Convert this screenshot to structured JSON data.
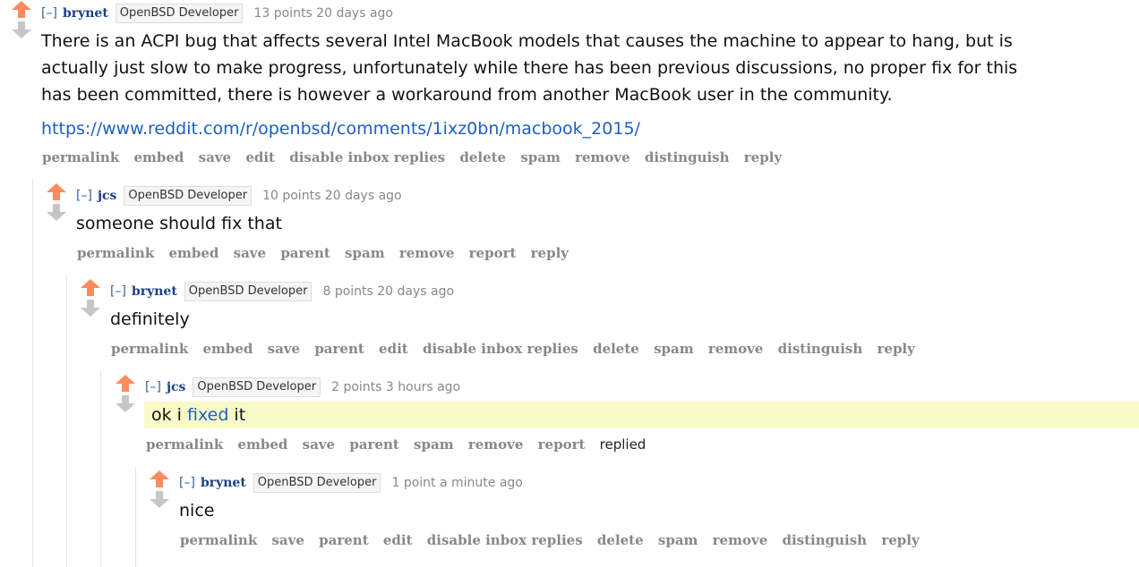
{
  "colors": {
    "upvote": "#ff8b60",
    "downvote": "#c6c6c6",
    "author": "#1a3f88",
    "link": "#1e5fc4",
    "highlight": "#fafac8"
  },
  "comments": [
    {
      "expand": "[–]",
      "author": "brynet",
      "flair": "OpenBSD Developer",
      "score": "13 points 20 days ago",
      "body_lines": [
        "There is an ACPI bug that affects several Intel MacBook models that causes the machine to appear to hang, but is",
        "actually just slow to make progress, unfortunately while there has been previous discussions, no proper fix for this",
        "has been committed, there is however a workaround from another MacBook user in the community."
      ],
      "link": "https://www.reddit.com/r/openbsd/comments/1ixz0bn/macbook_2015/",
      "buttons": [
        "permalink",
        "embed",
        "save",
        "edit",
        "disable inbox replies",
        "delete",
        "spam",
        "remove",
        "distinguish",
        "reply"
      ]
    },
    {
      "expand": "[–]",
      "author": "jcs",
      "flair": "OpenBSD Developer",
      "score": "10 points 20 days ago",
      "body": "someone should fix that",
      "buttons": [
        "permalink",
        "embed",
        "save",
        "parent",
        "spam",
        "remove",
        "report",
        "reply"
      ]
    },
    {
      "expand": "[–]",
      "author": "brynet",
      "flair": "OpenBSD Developer",
      "score": "8 points 20 days ago",
      "body": "definitely",
      "buttons": [
        "permalink",
        "embed",
        "save",
        "parent",
        "edit",
        "disable inbox replies",
        "delete",
        "spam",
        "remove",
        "distinguish",
        "reply"
      ]
    },
    {
      "expand": "[–]",
      "author": "jcs",
      "flair": "OpenBSD Developer",
      "score": "2 points 3 hours ago",
      "body_pre": "ok i ",
      "body_link": "fixed",
      "body_post": " it",
      "buttons": [
        "permalink",
        "embed",
        "save",
        "parent",
        "spam",
        "remove",
        "report"
      ],
      "replied": "replied"
    },
    {
      "expand": "[–]",
      "author": "brynet",
      "flair": "OpenBSD Developer",
      "score": "1 point a minute ago",
      "body": "nice",
      "buttons": [
        "permalink",
        "save",
        "parent",
        "edit",
        "disable inbox replies",
        "delete",
        "spam",
        "remove",
        "distinguish",
        "reply"
      ]
    }
  ]
}
